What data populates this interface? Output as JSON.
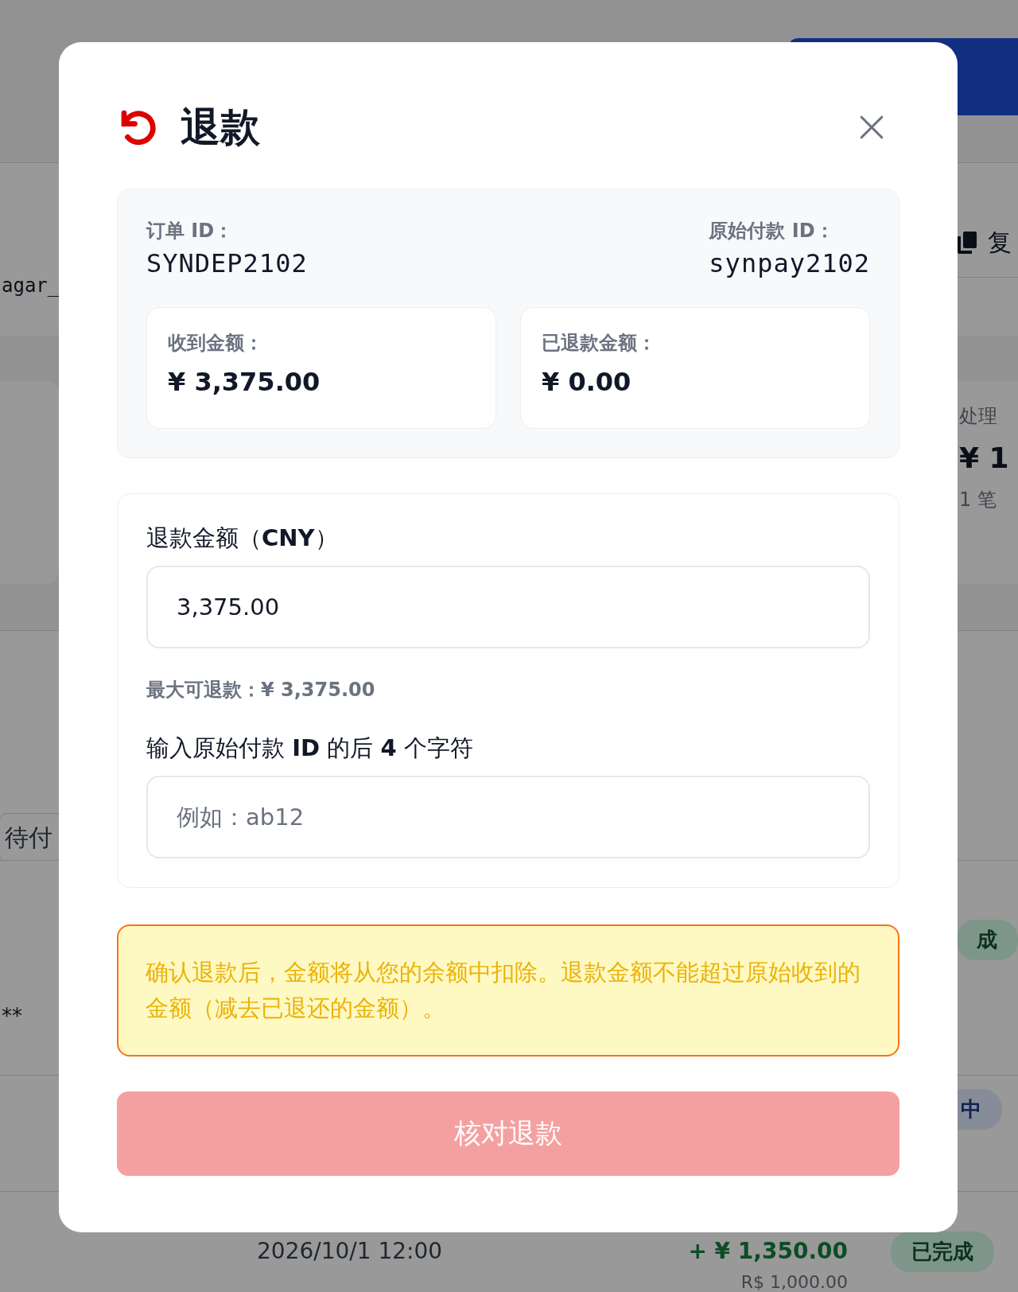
{
  "background_page": {
    "reference_fragment": "agar_",
    "copy_label": "复",
    "summary_card": {
      "label": "处理",
      "amount": "¥ 1",
      "count": "1 笔"
    },
    "status_fragment": "待付",
    "masked_fragment": "**",
    "badges": [
      {
        "label": "成",
        "kind": "success"
      },
      {
        "label": "中",
        "kind": "processing"
      }
    ],
    "last_row": {
      "time": "2026/10/1 12:00",
      "amount": "+ ¥ 1,350.00",
      "original_amount": "R$ 1,000.00",
      "status": {
        "label": "已完成",
        "kind": "success"
      }
    }
  },
  "dialog": {
    "title": "退款",
    "order_id_label": "订单 ID：",
    "order_id": "SYNDEP2102",
    "payment_id_label": "原始付款 ID：",
    "payment_id": "synpay2102",
    "amounts": [
      {
        "label": "收到金额：",
        "value": "¥ 3,375.00"
      },
      {
        "label": "已退款金额：",
        "value": "¥ 0.00"
      }
    ],
    "refund_amount_label": "退款金额（**CNY**）",
    "refund_amount_value": "3,375.00",
    "max_refund": "最大可退款：¥ 3,375.00",
    "confirm_label": "输入原始付款 **ID** 的后 **4** 个字符",
    "confirm_placeholder": "例如：ab12",
    "warning": "确认退款后，金额将从您的余额中扣除。退款金额不能超过原始收到的金额（减去已退还的金额）。",
    "submit": {
      "label": "核对退款",
      "disabled": true
    }
  }
}
